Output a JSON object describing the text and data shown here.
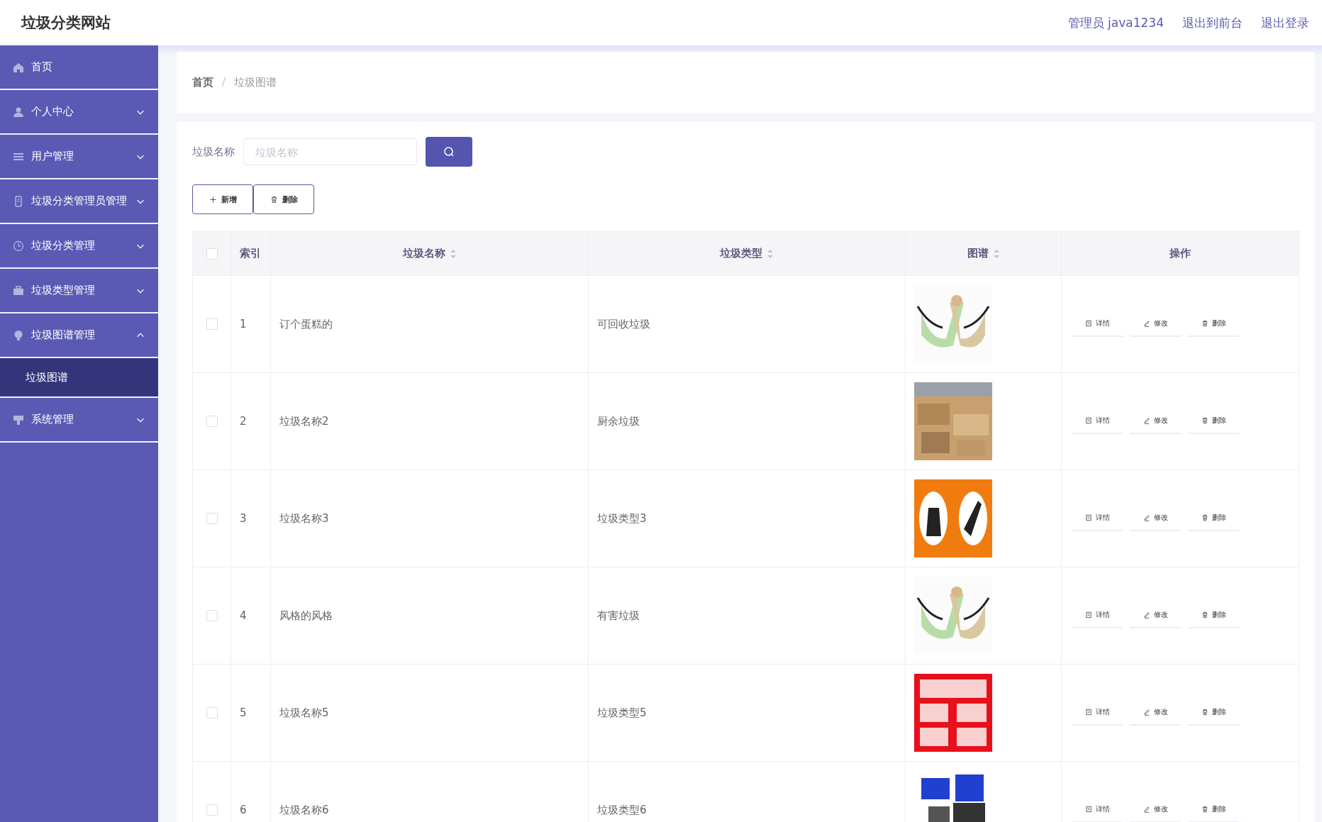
{
  "header": {
    "title": "垃圾分类网站",
    "links": [
      "管理员 java1234",
      "退出到前台",
      "退出登录"
    ]
  },
  "sidebar": {
    "items": [
      {
        "label": "首页"
      },
      {
        "label": "个人中心",
        "expanded": false
      },
      {
        "label": "用户管理",
        "expanded": false
      },
      {
        "label": "垃圾分类管理员管理",
        "expanded": false
      },
      {
        "label": "垃圾分类管理",
        "expanded": false
      },
      {
        "label": "垃圾类型管理",
        "expanded": false
      },
      {
        "label": "垃圾图谱管理",
        "expanded": true,
        "children": [
          {
            "label": "垃圾图谱",
            "selected": true
          }
        ]
      },
      {
        "label": "系统管理",
        "expanded": false
      }
    ]
  },
  "breadcrumb": {
    "separator": "/",
    "items": [
      "首页",
      "垃圾图谱"
    ]
  },
  "search": {
    "label": "垃圾名称",
    "placeholder": "垃圾名称"
  },
  "toolbar": [
    "新增",
    "删除"
  ],
  "table": {
    "select_all": {
      "checked": false
    },
    "columns": [
      {
        "label": "索引",
        "sortable": false
      },
      {
        "label": "垃圾名称",
        "sortable": true
      },
      {
        "label": "垃圾类型",
        "sortable": true
      },
      {
        "label": "图谱",
        "sortable": true
      },
      {
        "label": "操作",
        "sortable": false
      }
    ],
    "rows": [
      {
        "checked": false,
        "index": "1",
        "name": "订个蛋糕的",
        "type": "可回收垃圾",
        "actions": [
          "详情",
          "修改",
          "删除"
        ]
      },
      {
        "checked": false,
        "index": "2",
        "name": "垃圾名称2",
        "type": "厨余垃圾",
        "actions": [
          "详情",
          "修改",
          "删除"
        ]
      },
      {
        "checked": false,
        "index": "3",
        "name": "垃圾名称3",
        "type": "垃圾类型3",
        "actions": [
          "详情",
          "修改",
          "删除"
        ]
      },
      {
        "checked": false,
        "index": "4",
        "name": "风格的风格",
        "type": "有害垃圾",
        "actions": [
          "详情",
          "修改",
          "删除"
        ]
      },
      {
        "checked": false,
        "index": "5",
        "name": "垃圾名称5",
        "type": "垃圾类型5",
        "actions": [
          "详情",
          "修改",
          "删除"
        ]
      },
      {
        "checked": false,
        "index": "6",
        "name": "垃圾名称6",
        "type": "垃圾类型6",
        "actions": [
          "详情",
          "修改",
          "删除"
        ]
      }
    ]
  }
}
